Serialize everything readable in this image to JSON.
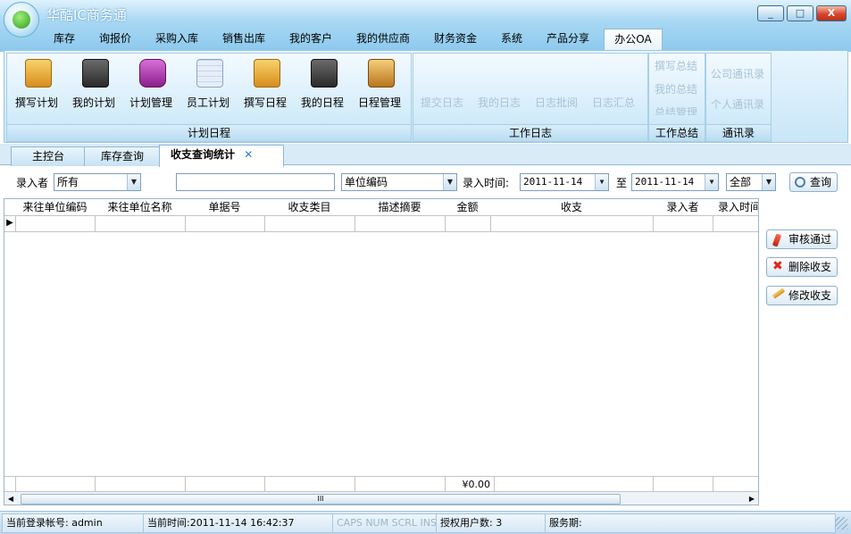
{
  "window": {
    "title": "华酷IC商务通",
    "minimize": "_",
    "maximize": "□",
    "close": "X"
  },
  "menu": {
    "items": [
      "库存",
      "询报价",
      "采购入库",
      "销售出库",
      "我的客户",
      "我的供应商",
      "财务资金",
      "系统",
      "产品分享",
      "办公OA"
    ],
    "active": "办公OA"
  },
  "ribbon": {
    "plan_group": {
      "footer": "计划日程",
      "buttons": [
        "撰写计划",
        "我的计划",
        "计划管理",
        "员工计划",
        "撰写日程",
        "我的日程",
        "日程管理"
      ]
    },
    "log_group": {
      "footer": "工作日志",
      "buttons": [
        "提交日志",
        "我的日志",
        "日志批阅",
        "日志汇总"
      ]
    },
    "summary_group": {
      "footer": "工作总结",
      "buttons": [
        "撰写总结",
        "我的总结",
        "总结管理"
      ]
    },
    "contacts_group": {
      "footer": "通讯录",
      "buttons": [
        "公司通讯录",
        "个人通讯录"
      ]
    }
  },
  "doc_tabs": {
    "items": [
      "主控台",
      "库存查询",
      "收支查询统计"
    ],
    "close_glyph": "✕"
  },
  "filter": {
    "entrant_label": "录入者",
    "entrant_value": "所有",
    "keyword_value": "",
    "field_value": "单位编码",
    "time_label": "录入时间:",
    "date_from": "2011-11-14",
    "to_label": "至",
    "date_to": "2011-11-14",
    "scope_value": "全部",
    "query_button": "查询"
  },
  "grid": {
    "columns": [
      "来往单位编码",
      "来往单位名称",
      "单据号",
      "收支类目",
      "描述摘要",
      "金额",
      "收支",
      "录入者",
      "录入时间"
    ],
    "row_marker": "▶",
    "total_amount": "¥0.00",
    "scroll_grip": "III"
  },
  "side_buttons": {
    "approve": "审核通过",
    "delete": "删除收支",
    "edit": "修改收支"
  },
  "status": {
    "login": "当前登录帐号: admin",
    "time": "当前时间:2011-11-14 16:42:37",
    "keys": "CAPS NUM SCRL INS",
    "licensed": "授权用户数: 3",
    "service": "服务期:"
  },
  "colors": {
    "accent": "#8cc9ee",
    "ribbon_bg": "#c9e6f8",
    "disabled_text": "#a9c2d4"
  }
}
